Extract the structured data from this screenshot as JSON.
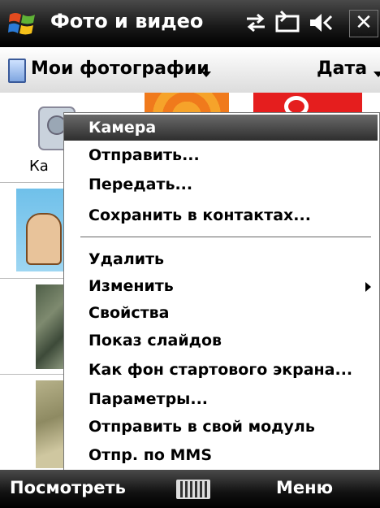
{
  "titlebar": {
    "title": "Фото и видео",
    "icons": [
      "windows-logo-icon",
      "connectivity-icon",
      "sync-icon",
      "volume-icon",
      "close-icon"
    ],
    "close_label": "✕"
  },
  "folderbar": {
    "folder": "Мои фотографии",
    "sort": "Дата"
  },
  "thumbnails": {
    "camera_label": "Ка"
  },
  "context_menu": {
    "items": [
      {
        "label": "Камера"
      },
      {
        "label": "Отправить..."
      },
      {
        "label": "Передать..."
      },
      {
        "label": "Сохранить в контактах..."
      },
      {
        "label": "Удалить"
      },
      {
        "label": "Изменить"
      },
      {
        "label": "Свойства"
      },
      {
        "label": "Показ слайдов"
      },
      {
        "label": "Как фон стартового экрана..."
      },
      {
        "label": "Параметры..."
      },
      {
        "label": "Отправить в свой модуль"
      },
      {
        "label": "Отпр. по MMS"
      }
    ]
  },
  "softkeys": {
    "left": "Посмотреть",
    "right": "Меню"
  },
  "colors": {
    "titlebar": "#1a1a1a",
    "selected_item": "#3e3e3e",
    "menu_bg": "#ffffff"
  }
}
